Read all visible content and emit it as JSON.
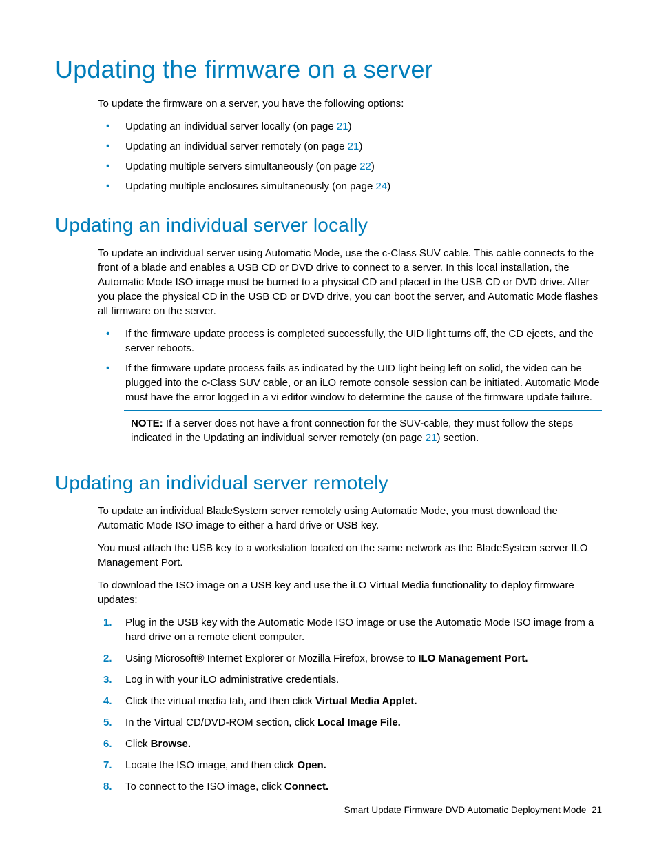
{
  "h1": "Updating the firmware on a server",
  "intro": "To update the firmware on a server, you have the following options:",
  "options": [
    {
      "text": "Updating an individual server locally (on page ",
      "link": "21",
      "tail": ")"
    },
    {
      "text": "Updating an individual server remotely (on page ",
      "link": "21",
      "tail": ")"
    },
    {
      "text": "Updating multiple servers simultaneously (on page ",
      "link": "22",
      "tail": ")"
    },
    {
      "text": "Updating multiple enclosures simultaneously (on page ",
      "link": "24",
      "tail": ")"
    }
  ],
  "sec1": {
    "title": "Updating an individual server locally",
    "para": "To update an individual server using Automatic Mode, use the c-Class SUV cable. This cable connects to the front of a blade and enables a USB CD or DVD drive to connect to a server. In this local installation, the Automatic Mode ISO image must be burned to a physical CD and placed in the USB CD or DVD drive. After you place the physical CD in the USB CD or DVD drive, you can boot the server, and Automatic Mode flashes all firmware on the server.",
    "bullets": [
      "If the firmware update process is completed successfully, the UID light turns off, the CD ejects, and the server reboots.",
      "If the firmware update process fails as indicated by the UID light being left on solid, the video can be plugged into the c-Class SUV cable, or an iLO remote console session can be initiated. Automatic Mode must have the error logged in a vi editor window to determine the cause of the firmware update failure."
    ],
    "note_label": "NOTE:",
    "note_pre": "  If a server does not have a front connection for the SUV-cable, they must follow the steps indicated in the Updating an individual server remotely (on page ",
    "note_link": "21",
    "note_post": ") section."
  },
  "sec2": {
    "title": "Updating an individual server remotely",
    "p1": "To update an individual BladeSystem server remotely using Automatic Mode, you must download the Automatic Mode ISO image to either a hard drive or USB key.",
    "p2": "You must attach the USB key to a workstation located on the same network as the BladeSystem server ILO Management Port.",
    "p3": "To download the ISO image on a USB key and use the iLO Virtual Media functionality to deploy firmware updates:",
    "steps": {
      "s1": "Plug in the USB key with the Automatic Mode ISO image or use the Automatic Mode ISO image from a hard drive on a remote client computer.",
      "s2a": "Using Microsoft® Internet Explorer or Mozilla Firefox, browse to ",
      "s2b": "ILO Management Port.",
      "s3": "Log in with your iLO administrative credentials.",
      "s4a": "Click the virtual media tab, and then click ",
      "s4b": "Virtual Media Applet.",
      "s5a": "In the Virtual CD/DVD-ROM section, click ",
      "s5b": "Local Image File.",
      "s6a": "Click ",
      "s6b": "Browse.",
      "s7a": "Locate the ISO image, and then click ",
      "s7b": "Open.",
      "s8a": "To connect to the ISO image, click ",
      "s8b": "Connect."
    }
  },
  "footer": {
    "text": "Smart Update Firmware DVD Automatic Deployment Mode",
    "page": "21"
  }
}
